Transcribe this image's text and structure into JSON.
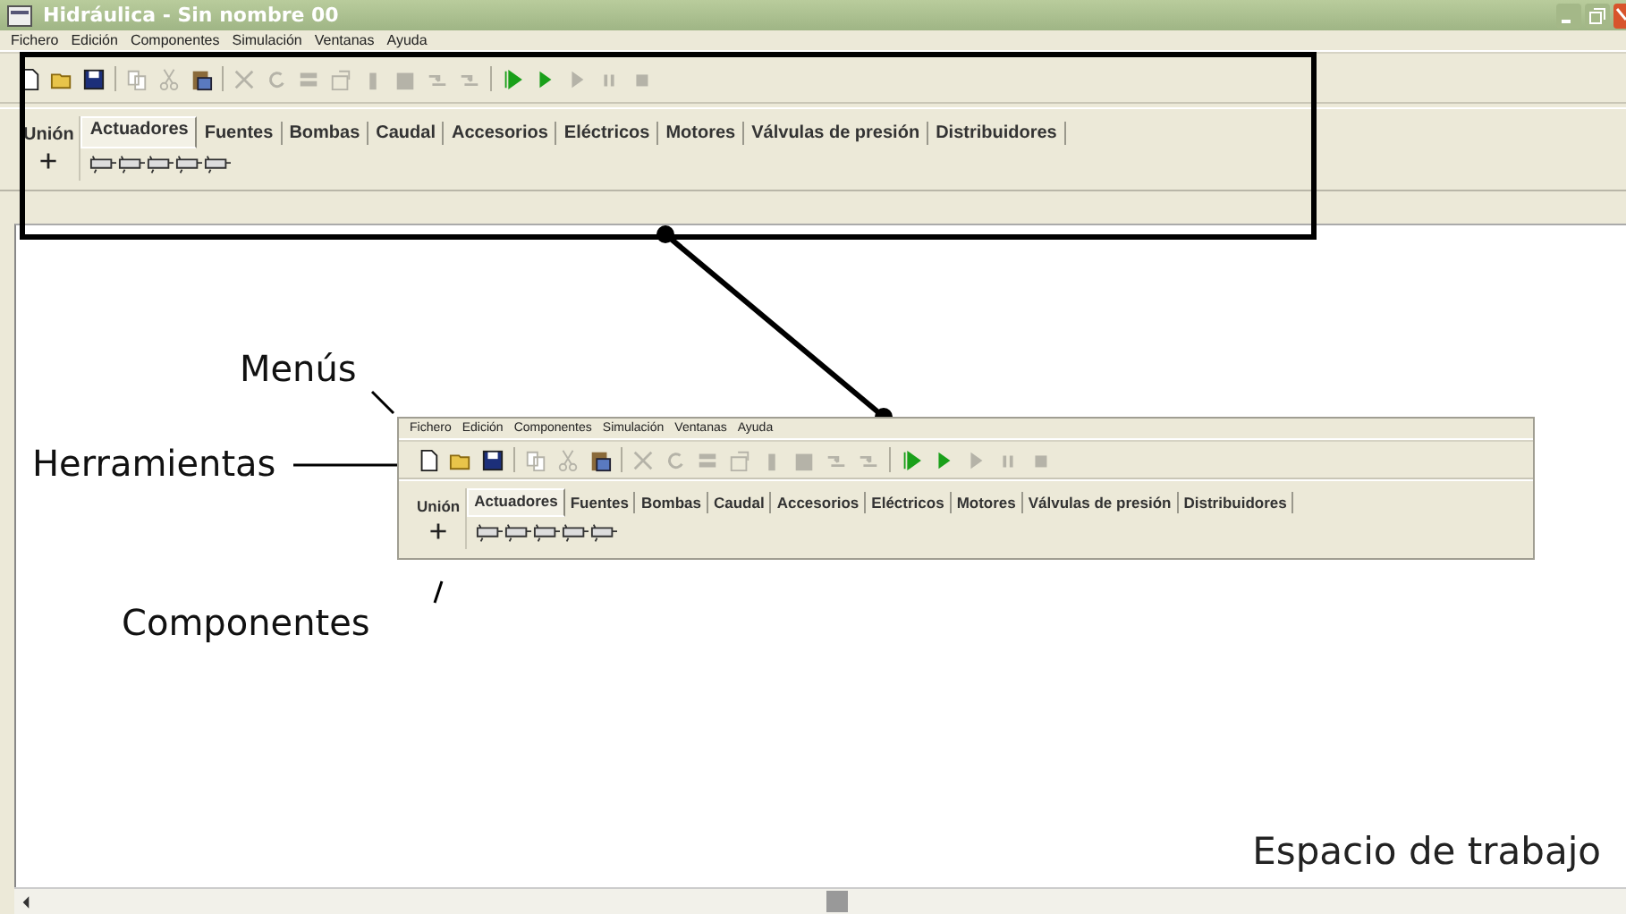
{
  "window": {
    "title": "Hidráulica - Sin nombre 00"
  },
  "toolbars": [
    {
      "menu": [
        "Fichero",
        "Edición",
        "Componentes",
        "Simulación",
        "Ventanas",
        "Ayuda"
      ],
      "tools": [
        {
          "kind": "new",
          "disabled": false
        },
        {
          "kind": "open",
          "disabled": false
        },
        {
          "kind": "save",
          "disabled": false
        },
        {
          "kind": "separator"
        },
        {
          "kind": "copy",
          "disabled": true
        },
        {
          "kind": "cut",
          "disabled": true
        },
        {
          "kind": "paste",
          "disabled": false
        },
        {
          "kind": "separator"
        },
        {
          "kind": "delete",
          "disabled": true
        },
        {
          "kind": "rotate",
          "disabled": true
        },
        {
          "kind": "align",
          "disabled": true
        },
        {
          "kind": "properties",
          "disabled": true
        },
        {
          "kind": "bar",
          "disabled": true
        },
        {
          "kind": "block",
          "disabled": true
        },
        {
          "kind": "flip",
          "disabled": true
        },
        {
          "kind": "flip",
          "disabled": true
        },
        {
          "kind": "separator"
        },
        {
          "kind": "run",
          "disabled": false
        },
        {
          "kind": "play",
          "disabled": false
        },
        {
          "kind": "play",
          "disabled": true
        },
        {
          "kind": "pause",
          "disabled": true
        },
        {
          "kind": "stop",
          "disabled": true
        }
      ],
      "panel_tab": "Unión",
      "tabs": [
        {
          "label": "Actuadores",
          "selected": true
        },
        {
          "label": "Fuentes",
          "selected": false
        },
        {
          "label": "Bombas",
          "selected": false
        },
        {
          "label": "Caudal",
          "selected": false
        },
        {
          "label": "Accesorios",
          "selected": false
        },
        {
          "label": "Eléctricos",
          "selected": false
        },
        {
          "label": "Motores",
          "selected": false
        },
        {
          "label": "Válvulas de presión",
          "selected": false
        },
        {
          "label": "Distribuidores",
          "selected": false
        }
      ],
      "components": [
        {
          "kind": "junction"
        },
        {
          "kind": "cylinder"
        },
        {
          "kind": "cylinder"
        },
        {
          "kind": "cylinder"
        },
        {
          "kind": "cylinder"
        },
        {
          "kind": "cylinder"
        }
      ]
    },
    {
      "menu": [
        "Fichero",
        "Edición",
        "Componentes",
        "Simulación",
        "Ventanas",
        "Ayuda"
      ],
      "tools": [
        {
          "kind": "new",
          "disabled": false
        },
        {
          "kind": "open",
          "disabled": false
        },
        {
          "kind": "save",
          "disabled": false
        },
        {
          "kind": "separator"
        },
        {
          "kind": "copy",
          "disabled": true
        },
        {
          "kind": "cut",
          "disabled": true
        },
        {
          "kind": "paste",
          "disabled": false
        },
        {
          "kind": "separator"
        },
        {
          "kind": "delete",
          "disabled": true
        },
        {
          "kind": "rotate",
          "disabled": true
        },
        {
          "kind": "align",
          "disabled": true
        },
        {
          "kind": "properties",
          "disabled": true
        },
        {
          "kind": "bar",
          "disabled": true
        },
        {
          "kind": "block",
          "disabled": true
        },
        {
          "kind": "flip",
          "disabled": true
        },
        {
          "kind": "flip",
          "disabled": true
        },
        {
          "kind": "separator"
        },
        {
          "kind": "run",
          "disabled": false
        },
        {
          "kind": "play",
          "disabled": false
        },
        {
          "kind": "play",
          "disabled": true
        },
        {
          "kind": "pause",
          "disabled": true
        },
        {
          "kind": "stop",
          "disabled": true
        }
      ],
      "panel_tab": "Unión",
      "tabs": [
        {
          "label": "Actuadores",
          "selected": true
        },
        {
          "label": "Fuentes",
          "selected": false
        },
        {
          "label": "Bombas",
          "selected": false
        },
        {
          "label": "Caudal",
          "selected": false
        },
        {
          "label": "Accesorios",
          "selected": false
        },
        {
          "label": "Eléctricos",
          "selected": false
        },
        {
          "label": "Motores",
          "selected": false
        },
        {
          "label": "Válvulas de presión",
          "selected": false
        },
        {
          "label": "Distribuidores",
          "selected": false
        }
      ],
      "components": [
        {
          "kind": "junction"
        },
        {
          "kind": "cylinder"
        },
        {
          "kind": "cylinder"
        },
        {
          "kind": "cylinder"
        },
        {
          "kind": "cylinder"
        },
        {
          "kind": "cylinder"
        }
      ]
    }
  ],
  "annotations": [
    {
      "kind": "menus",
      "text": "Menús"
    },
    {
      "kind": "tools",
      "text": "Herramientas"
    },
    {
      "kind": "components",
      "text": "Componentes"
    }
  ],
  "workspace_label": "Espacio de trabajo"
}
